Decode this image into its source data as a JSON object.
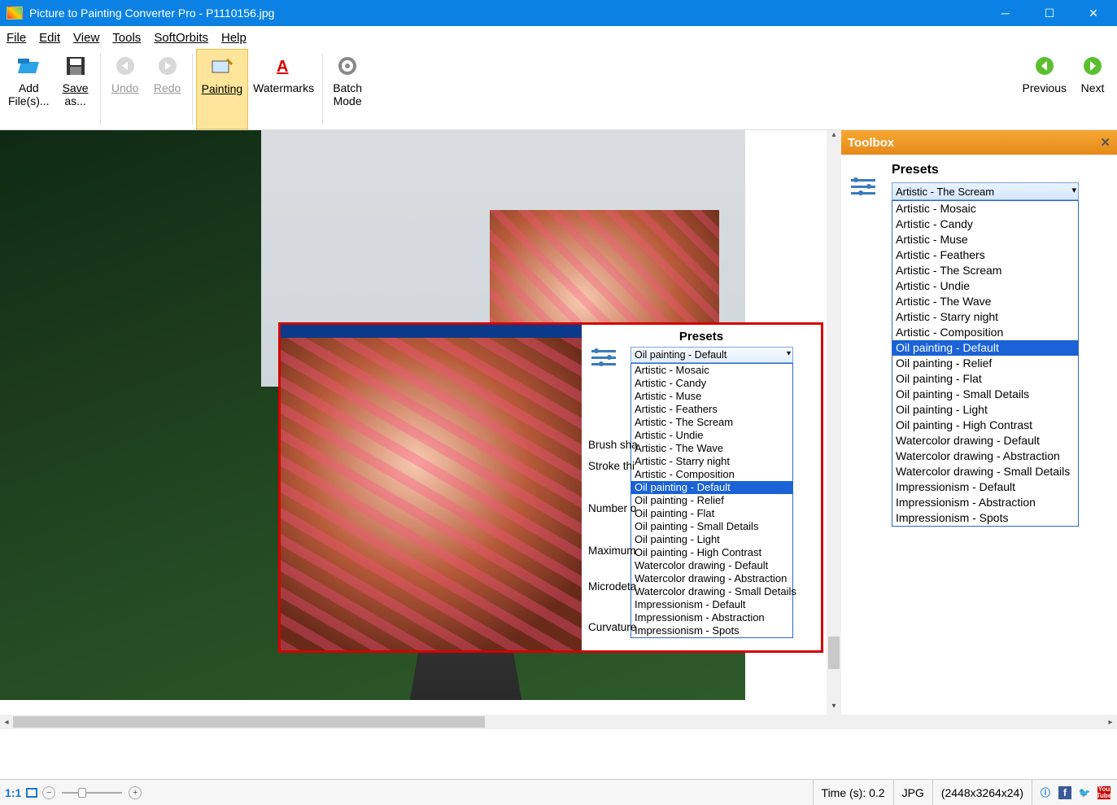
{
  "window": {
    "title": "Picture to Painting Converter Pro - P1110156.jpg"
  },
  "menu": {
    "file": "File",
    "edit": "Edit",
    "view": "View",
    "tools": "Tools",
    "softorbits": "SoftOrbits",
    "help": "Help"
  },
  "toolbar": {
    "add_files_l1": "Add",
    "add_files_l2": "File(s)...",
    "save_as_l1": "Save",
    "save_as_l2": "as...",
    "undo": "Undo",
    "redo": "Redo",
    "painting": "Painting",
    "watermarks": "Watermarks",
    "batch_l1": "Batch",
    "batch_l2": "Mode",
    "previous": "Previous",
    "next": "Next"
  },
  "toolbox": {
    "title": "Toolbox",
    "presets_label": "Presets",
    "selected": "Artistic - The Scream",
    "highlighted": "Oil painting - Default",
    "options": [
      "Artistic - Mosaic",
      "Artistic - Candy",
      "Artistic - Muse",
      "Artistic - Feathers",
      "Artistic - The Scream",
      "Artistic - Undie",
      "Artistic - The Wave",
      "Artistic - Starry night",
      "Artistic - Composition",
      "Oil painting - Default",
      "Oil painting - Relief",
      "Oil painting - Flat",
      "Oil painting - Small Details",
      "Oil painting - Light",
      "Oil painting - High Contrast",
      "Watercolor drawing - Default",
      "Watercolor drawing - Abstraction",
      "Watercolor drawing - Small Details",
      "Impressionism - Default",
      "Impressionism - Abstraction",
      "Impressionism - Spots"
    ]
  },
  "overlay": {
    "presets_label": "Presets",
    "selected": "Oil painting - Default",
    "highlighted": "Oil painting - Default",
    "options": [
      "Artistic - Mosaic",
      "Artistic - Candy",
      "Artistic - Muse",
      "Artistic - Feathers",
      "Artistic - The Scream",
      "Artistic - Undie",
      "Artistic - The Wave",
      "Artistic - Starry night",
      "Artistic - Composition",
      "Oil painting - Default",
      "Oil painting - Relief",
      "Oil painting - Flat",
      "Oil painting - Small Details",
      "Oil painting - Light",
      "Oil painting - High Contrast",
      "Watercolor drawing - Default",
      "Watercolor drawing - Abstraction",
      "Watercolor drawing - Small Details",
      "Impressionism - Default",
      "Impressionism - Abstraction",
      "Impressionism - Spots"
    ],
    "params": {
      "brush_sha": "Brush sha",
      "stroke_thi": "Stroke thi",
      "number_o": "Number o",
      "maximum": "Maximum",
      "microdeta": "Microdeta",
      "curvature": "Curvature"
    }
  },
  "status": {
    "zoom_label": "1:1",
    "time": "Time (s): 0.2",
    "format": "JPG",
    "dims": "(2448x3264x24)"
  }
}
